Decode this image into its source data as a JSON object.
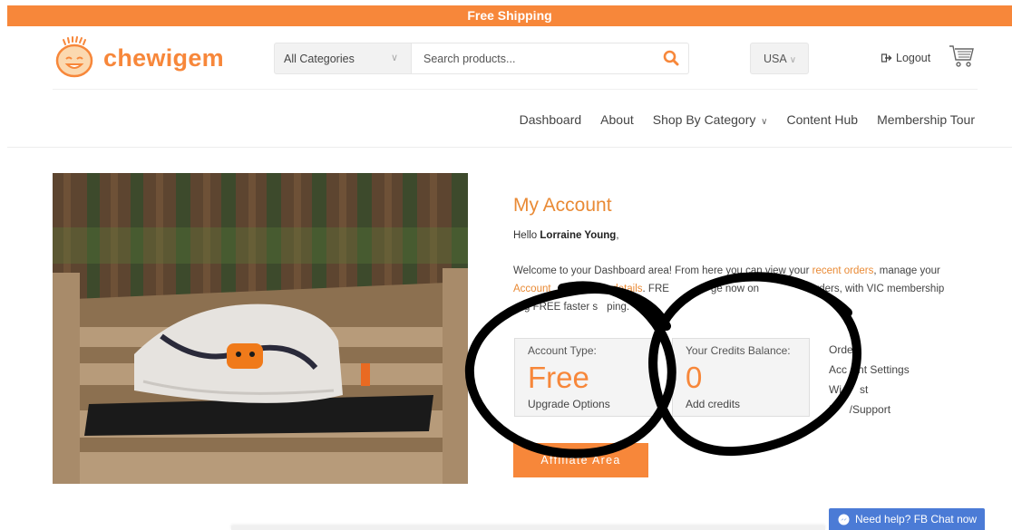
{
  "banner": {
    "text": "Free Shipping"
  },
  "header": {
    "logo_text": "chewigem",
    "category_select": {
      "value": "All Categories"
    },
    "search": {
      "placeholder": "Search products..."
    },
    "country_select": {
      "value": "USA"
    },
    "logout_label": "Logout"
  },
  "nav": {
    "items": [
      {
        "label": "Dashboard"
      },
      {
        "label": "About"
      },
      {
        "label": "Shop By Category"
      },
      {
        "label": "Content Hub"
      },
      {
        "label": "Membership Tour"
      }
    ]
  },
  "account": {
    "title": "My Account",
    "hello_prefix": "Hello ",
    "user_name": "Lorraine Young",
    "hello_suffix": ",",
    "welcome": {
      "line1_a": "Welcome to your Dashboard area! From here you can view your ",
      "recent_orders": "recent orders",
      "line1_b": ", manage your",
      "account_fragment": "Account",
      "address_fragment": "ddress details",
      "line2_a": ". FRE",
      "line2_b": "ge now on",
      "line2_c": "orders, with VIC membership",
      "line3_a": "g FREE faster s",
      "line3_b": "ping."
    },
    "account_type": {
      "label": "Account Type:",
      "value": "Free",
      "action": "Upgrade Options"
    },
    "credits": {
      "label": "Your Credits Balance:",
      "value": "0",
      "action": "Add credits"
    },
    "side_links": [
      {
        "label": "Orde"
      },
      {
        "label": "Acc",
        "label_b": "nt Settings"
      },
      {
        "label": "Wi",
        "label_b": "st"
      },
      {
        "label": "H",
        "label_b": "/Support"
      }
    ],
    "affiliate_button": "Affiliate Area"
  },
  "fb_chat": {
    "label": "Need help? FB Chat now"
  },
  "colors": {
    "accent": "#f7873a",
    "link": "#e98a35",
    "chat": "#4b7bd6"
  }
}
